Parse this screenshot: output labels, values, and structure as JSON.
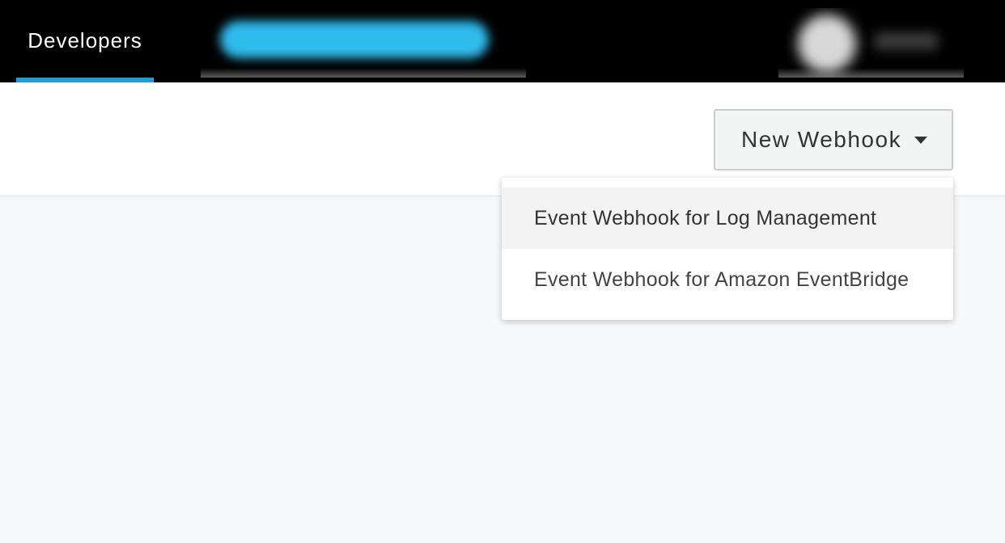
{
  "header": {
    "tabs": [
      {
        "label": "Developers",
        "active": true
      }
    ]
  },
  "toolbar": {
    "new_webhook_label": "New Webhook"
  },
  "dropdown": {
    "items": [
      {
        "label": "Event Webhook for Log Management",
        "hovered": true
      },
      {
        "label": "Event Webhook for Amazon EventBridge",
        "hovered": false
      }
    ]
  },
  "colors": {
    "accent": "#1a9dd8",
    "topbar": "#000000",
    "page_background": "#f7f8f9"
  },
  "icons": {
    "dropdown_caret": "caret-down-icon"
  }
}
